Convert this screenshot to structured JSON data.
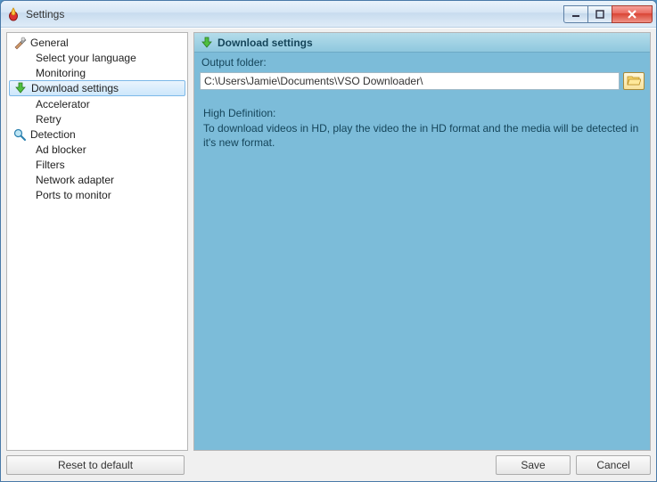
{
  "window": {
    "title": "Settings"
  },
  "tree": {
    "general": {
      "label": "General"
    },
    "select_language": {
      "label": "Select your language"
    },
    "monitoring": {
      "label": "Monitoring"
    },
    "download_settings": {
      "label": "Download settings"
    },
    "accelerator": {
      "label": "Accelerator"
    },
    "retry": {
      "label": "Retry"
    },
    "detection": {
      "label": "Detection"
    },
    "ad_blocker": {
      "label": "Ad blocker"
    },
    "filters": {
      "label": "Filters"
    },
    "network_adapter": {
      "label": "Network adapter"
    },
    "ports_to_monitor": {
      "label": "Ports to monitor"
    }
  },
  "detail": {
    "header": "Download settings",
    "output_folder_label": "Output folder:",
    "output_folder_value": "C:\\Users\\Jamie\\Documents\\VSO Downloader\\",
    "hd_title": "High Definition:",
    "hd_text": "To download videos in HD, play the video the in HD format and the media will be detected in it's new format."
  },
  "buttons": {
    "reset": "Reset to default",
    "save": "Save",
    "cancel": "Cancel"
  }
}
